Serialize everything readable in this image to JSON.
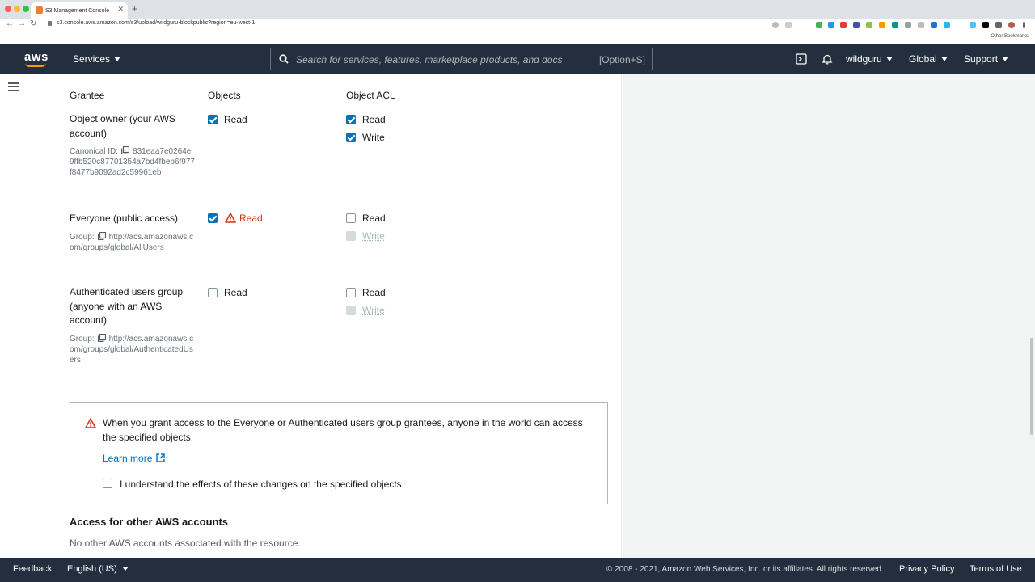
{
  "browser": {
    "tab_title": "S3 Management Console",
    "url": "s3.console.aws.amazon.com/s3/upload/wildguru-blockpublic?region=eu-west-1",
    "bookmarks_label": "Other Bookmarks"
  },
  "topnav": {
    "logo": "aws",
    "services_label": "Services",
    "search_placeholder": "Search for services, features, marketplace products, and docs",
    "search_shortcut": "[Option+S]",
    "account": "wildguru",
    "region": "Global",
    "support": "Support"
  },
  "acl_table": {
    "headers": {
      "grantee": "Grantee",
      "objects": "Objects",
      "object_acl": "Object ACL"
    },
    "rows": [
      {
        "grantee": "Object owner (your AWS account)",
        "detail_label": "Canonical ID:",
        "detail_value": "831eaa7e0264e9ffb520c87701354a7bd4fbeb6f977f8477b9092ad2c59961eb",
        "objects_read": {
          "label": "Read",
          "checked": true
        },
        "acl_read": {
          "label": "Read",
          "checked": true
        },
        "acl_write": {
          "label": "Write",
          "checked": true
        }
      },
      {
        "grantee": "Everyone (public access)",
        "detail_label": "Group:",
        "detail_value": "http://acs.amazonaws.com/groups/global/AllUsers",
        "objects_read": {
          "label": "Read",
          "checked": true,
          "warning": true
        },
        "acl_read": {
          "label": "Read",
          "checked": false
        },
        "acl_write": {
          "label": "Write",
          "checked": false,
          "disabled": true
        }
      },
      {
        "grantee": "Authenticated users group (anyone with an AWS account)",
        "detail_label": "Group:",
        "detail_value": "http://acs.amazonaws.com/groups/global/AuthenticatedUsers",
        "objects_read": {
          "label": "Read",
          "checked": false
        },
        "acl_read": {
          "label": "Read",
          "checked": false
        },
        "acl_write": {
          "label": "Write",
          "checked": false,
          "disabled": true
        }
      }
    ]
  },
  "warning_alert": {
    "text": "When you grant access to the Everyone or Authenticated users group grantees, anyone in the world can access the specified objects.",
    "learn_more": "Learn more",
    "ack_label": "I understand the effects of these changes on the specified objects."
  },
  "other_accounts": {
    "title": "Access for other AWS accounts",
    "body": "No other AWS accounts associated with the resource."
  },
  "footer": {
    "feedback": "Feedback",
    "language": "English (US)",
    "copyright": "© 2008 - 2021, Amazon Web Services, Inc. or its affiliates. All rights reserved.",
    "privacy": "Privacy Policy",
    "terms": "Terms of Use"
  },
  "colors": {
    "nav_bg": "#232f3e",
    "checkbox_blue": "#0073bb",
    "warning_red": "#d13212",
    "link_blue": "#0073bb"
  }
}
